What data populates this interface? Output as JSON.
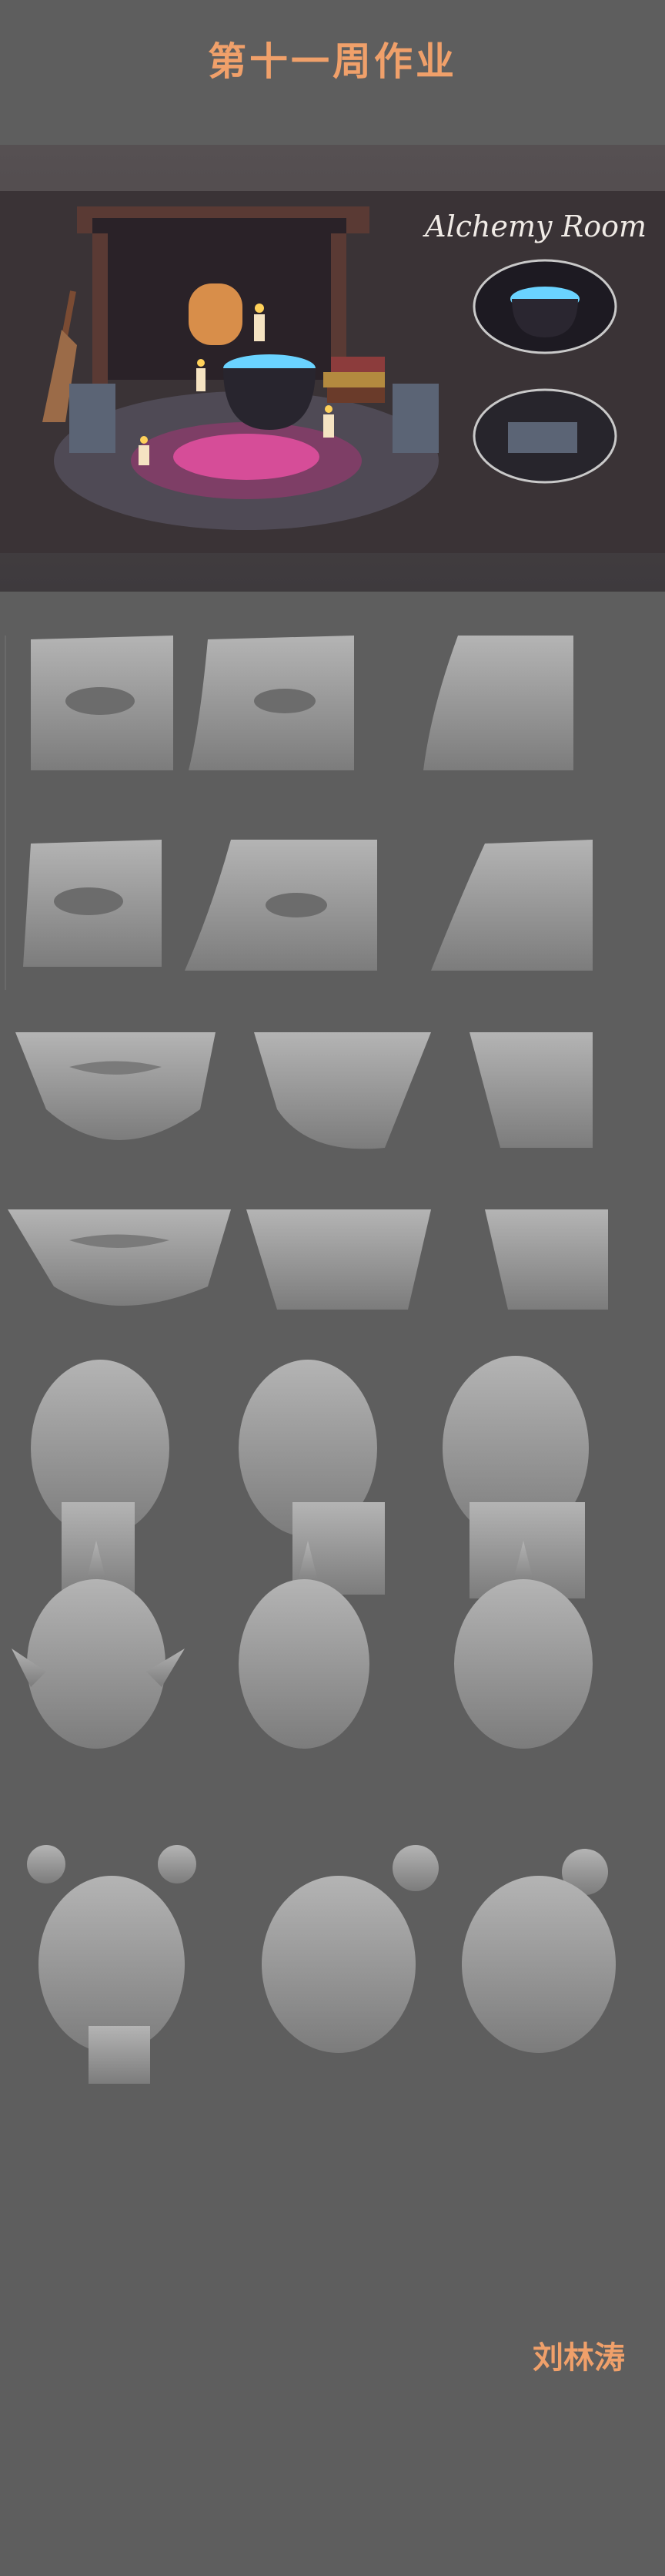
{
  "title": "第十一周作业",
  "banner_title": "Alchemy Room",
  "signature": "刘林涛",
  "colors": {
    "background": "#5e5e5e",
    "accent": "#f0a06a",
    "clay": "#9a9a9a",
    "potion": "#4b7bff"
  }
}
